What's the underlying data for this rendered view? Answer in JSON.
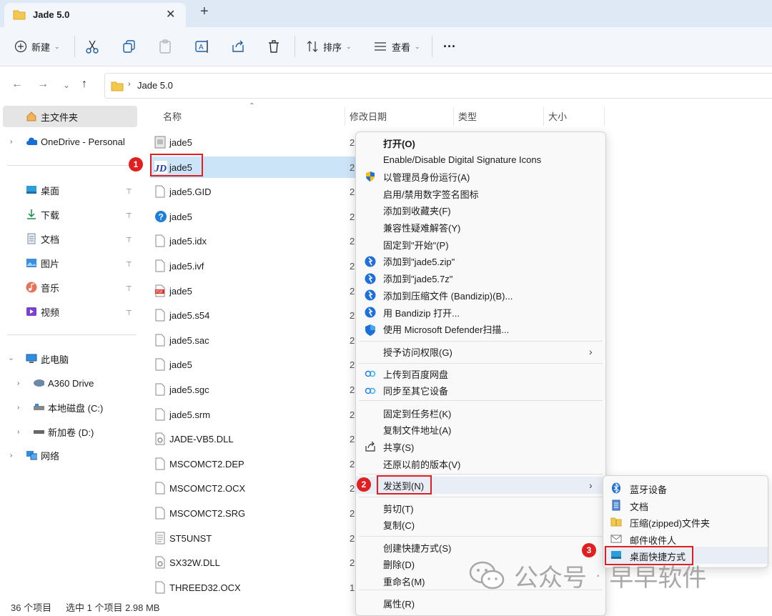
{
  "window": {
    "tab_title": "Jade 5.0",
    "close_glyph": "✕",
    "new_tab_glyph": "+"
  },
  "toolbar": {
    "new_label": "新建",
    "sort_label": "排序",
    "view_label": "查看",
    "more_glyph": "···"
  },
  "address": {
    "path": "Jade 5.0"
  },
  "sidebar": {
    "home": "主文件夹",
    "onedrive": "OneDrive - Personal",
    "pinned": [
      "桌面",
      "下载",
      "文档",
      "图片",
      "音乐",
      "视频"
    ],
    "this_pc": "此电脑",
    "drives": [
      "A360 Drive",
      "本地磁盘 (C:)",
      "新加卷 (D:)"
    ],
    "network": "网络"
  },
  "columns": {
    "name": "名称",
    "date": "修改日期",
    "type": "类型",
    "size": "大小"
  },
  "files": [
    {
      "name": "jade5",
      "date": "2",
      "icon": "generic-file-icon"
    },
    {
      "name": "jade5",
      "date": "2",
      "icon": "jade-app-icon"
    },
    {
      "name": "jade5.GID",
      "date": "2",
      "icon": "blank-file-icon"
    },
    {
      "name": "jade5",
      "date": "2",
      "icon": "help-icon"
    },
    {
      "name": "jade5.idx",
      "date": "2",
      "icon": "blank-file-icon"
    },
    {
      "name": "jade5.ivf",
      "date": "2",
      "icon": "blank-file-icon"
    },
    {
      "name": "jade5",
      "date": "2",
      "icon": "pdf-icon"
    },
    {
      "name": "jade5.s54",
      "date": "2",
      "icon": "blank-file-icon"
    },
    {
      "name": "jade5.sac",
      "date": "2",
      "icon": "blank-file-icon"
    },
    {
      "name": "jade5",
      "date": "2",
      "icon": "blank-file-icon"
    },
    {
      "name": "jade5.sgc",
      "date": "2",
      "icon": "blank-file-icon"
    },
    {
      "name": "jade5.srm",
      "date": "2",
      "icon": "blank-file-icon"
    },
    {
      "name": "JADE-VB5.DLL",
      "date": "2",
      "icon": "dll-icon"
    },
    {
      "name": "MSCOMCT2.DEP",
      "date": "2",
      "icon": "blank-file-icon"
    },
    {
      "name": "MSCOMCT2.OCX",
      "date": "2",
      "icon": "blank-file-icon"
    },
    {
      "name": "MSCOMCT2.SRG",
      "date": "2",
      "icon": "blank-file-icon"
    },
    {
      "name": "ST5UNST",
      "date": "2",
      "icon": "text-file-icon"
    },
    {
      "name": "SX32W.DLL",
      "date": "2",
      "icon": "dll-icon"
    },
    {
      "name": "THREED32.OCX",
      "date": "1",
      "icon": "blank-file-icon"
    }
  ],
  "status": {
    "count": "36 个项目",
    "selection": "选中 1 个项目  2.98 MB"
  },
  "context_menu": {
    "group1": [
      {
        "label": "打开(O)",
        "bold": true,
        "icon": ""
      },
      {
        "label": "Enable/Disable Digital Signature Icons",
        "icon": ""
      },
      {
        "label": "以管理员身份运行(A)",
        "icon": "uac-shield-icon"
      },
      {
        "label": "启用/禁用数字签名图标",
        "icon": ""
      },
      {
        "label": "添加到收藏夹(F)",
        "icon": ""
      },
      {
        "label": "兼容性疑难解答(Y)",
        "icon": ""
      },
      {
        "label": "固定到\"开始\"(P)",
        "icon": ""
      },
      {
        "label": "添加到\"jade5.zip\"",
        "icon": "bandizip-icon"
      },
      {
        "label": "添加到\"jade5.7z\"",
        "icon": "bandizip-icon"
      },
      {
        "label": "添加到压缩文件 (Bandizip)(B)...",
        "icon": "bandizip-icon"
      },
      {
        "label": "用 Bandizip 打开...",
        "icon": "bandizip-icon"
      },
      {
        "label": "使用 Microsoft Defender扫描...",
        "icon": "defender-shield-icon"
      }
    ],
    "grant_access": "授予访问权限(G)",
    "group3": [
      {
        "label": "上传到百度网盘",
        "icon": "baidu-icon"
      },
      {
        "label": "同步至其它设备",
        "icon": "baidu-icon"
      }
    ],
    "group4": [
      {
        "label": "固定到任务栏(K)",
        "icon": ""
      },
      {
        "label": "复制文件地址(A)",
        "icon": ""
      },
      {
        "label": "共享(S)",
        "icon": "share-icon"
      },
      {
        "label": "还原以前的版本(V)",
        "icon": ""
      }
    ],
    "send_to": "发送到(N)",
    "group6": [
      {
        "label": "剪切(T)"
      },
      {
        "label": "复制(C)"
      }
    ],
    "group7": [
      {
        "label": "创建快捷方式(S)"
      },
      {
        "label": "删除(D)"
      },
      {
        "label": "重命名(M)"
      }
    ],
    "properties": "属性(R)",
    "arrow_glyph": "›"
  },
  "send_to_menu": [
    {
      "label": "蓝牙设备",
      "icon": "bluetooth-icon"
    },
    {
      "label": "文档",
      "icon": "document-icon"
    },
    {
      "label": "压缩(zipped)文件夹",
      "icon": "zip-folder-icon"
    },
    {
      "label": "邮件收件人",
      "icon": "mail-icon"
    },
    {
      "label": "桌面快捷方式",
      "icon": "desktop-icon"
    }
  ],
  "annotations": [
    "1",
    "2",
    "3"
  ],
  "watermark": {
    "brand": "公众号",
    "dot": "·",
    "name": "早早软件"
  },
  "colors": {
    "accent": "#1b5ea8",
    "selection": "#cce4f7",
    "annotation_red": "#e02020"
  }
}
